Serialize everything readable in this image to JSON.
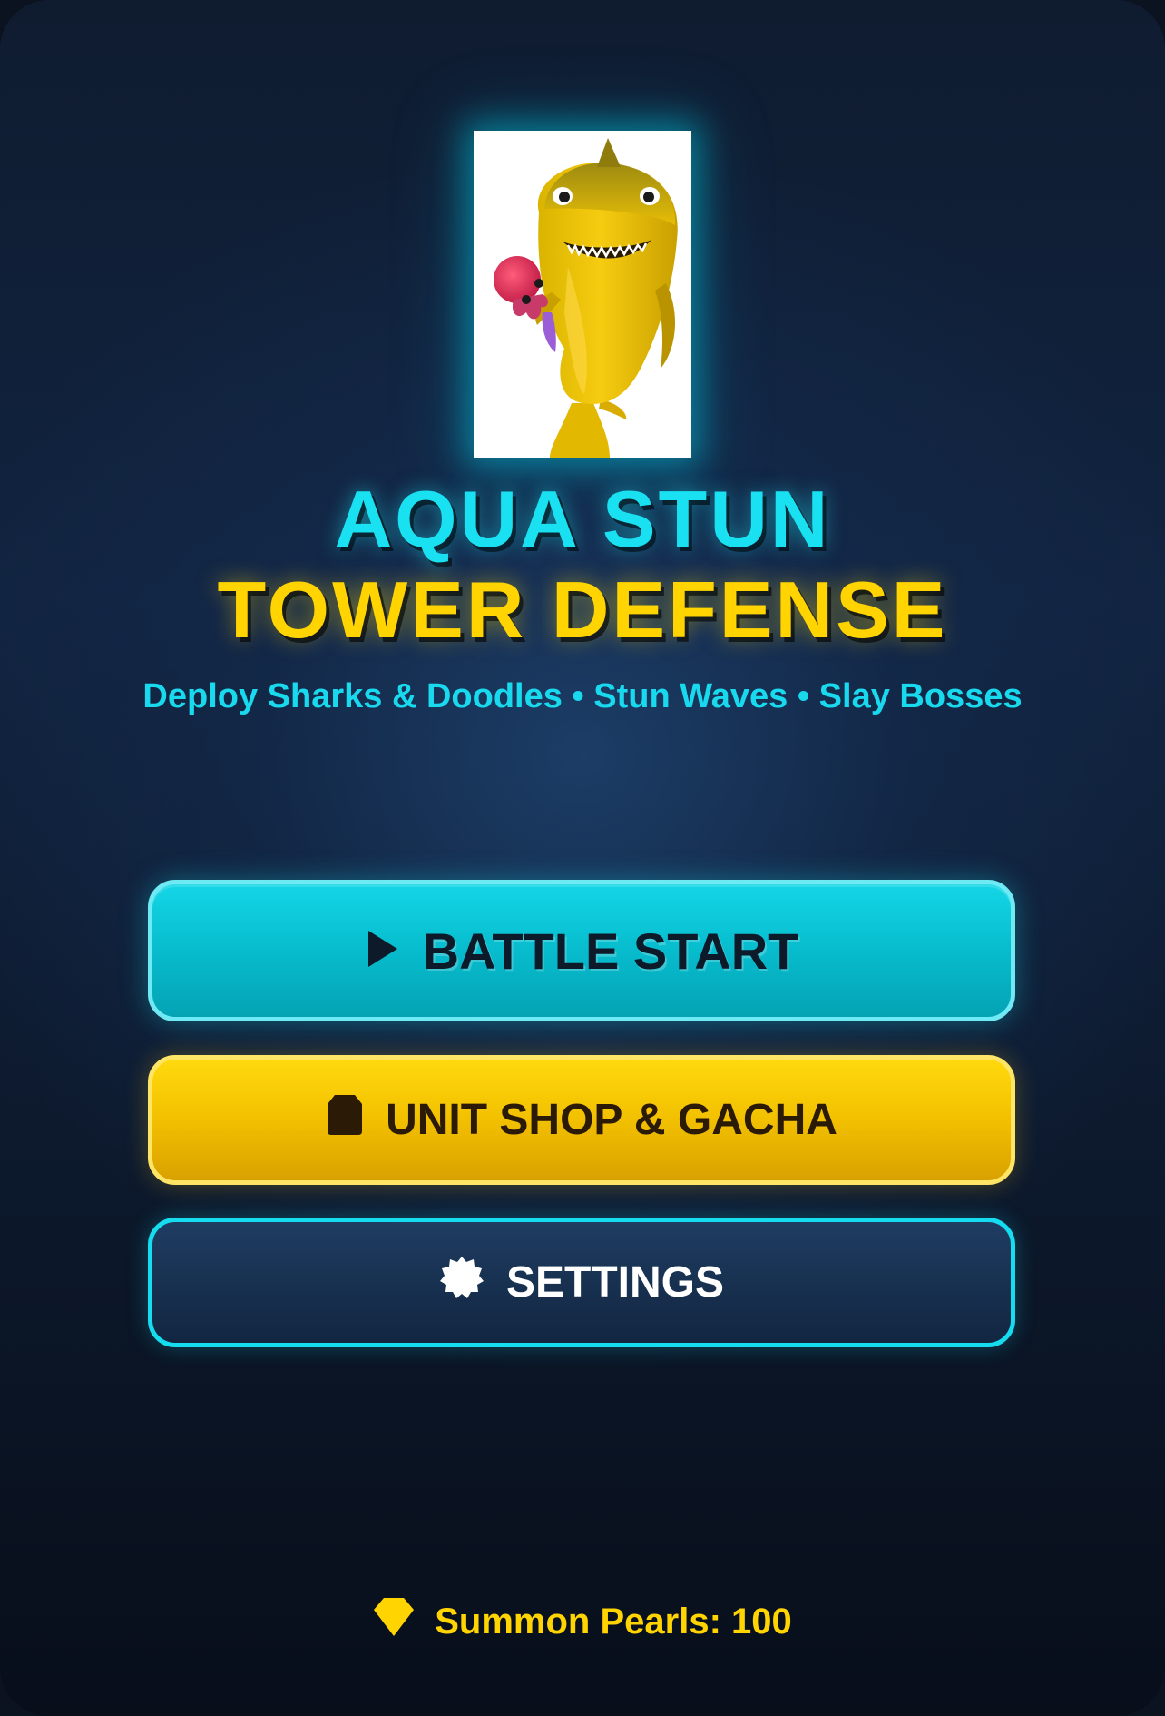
{
  "hero": {
    "icon": "shark-mascot-icon"
  },
  "title": {
    "line1": "AQUA STUN",
    "line2": "TOWER DEFENSE",
    "subtitle": "Deploy Sharks & Doodles • Stun Waves • Slay Bosses"
  },
  "menu": {
    "battle": {
      "label": "BATTLE START",
      "icon": "play-icon"
    },
    "shop": {
      "label": "UNIT SHOP & GACHA",
      "icon": "bag-icon"
    },
    "settings": {
      "label": "SETTINGS",
      "icon": "gear-icon"
    }
  },
  "currency": {
    "label": "Summon Pearls: 100",
    "icon": "diamond-icon"
  },
  "colors": {
    "accent_cyan": "#19e1f2",
    "accent_gold": "#ffd400",
    "background": "#0f1c30"
  }
}
